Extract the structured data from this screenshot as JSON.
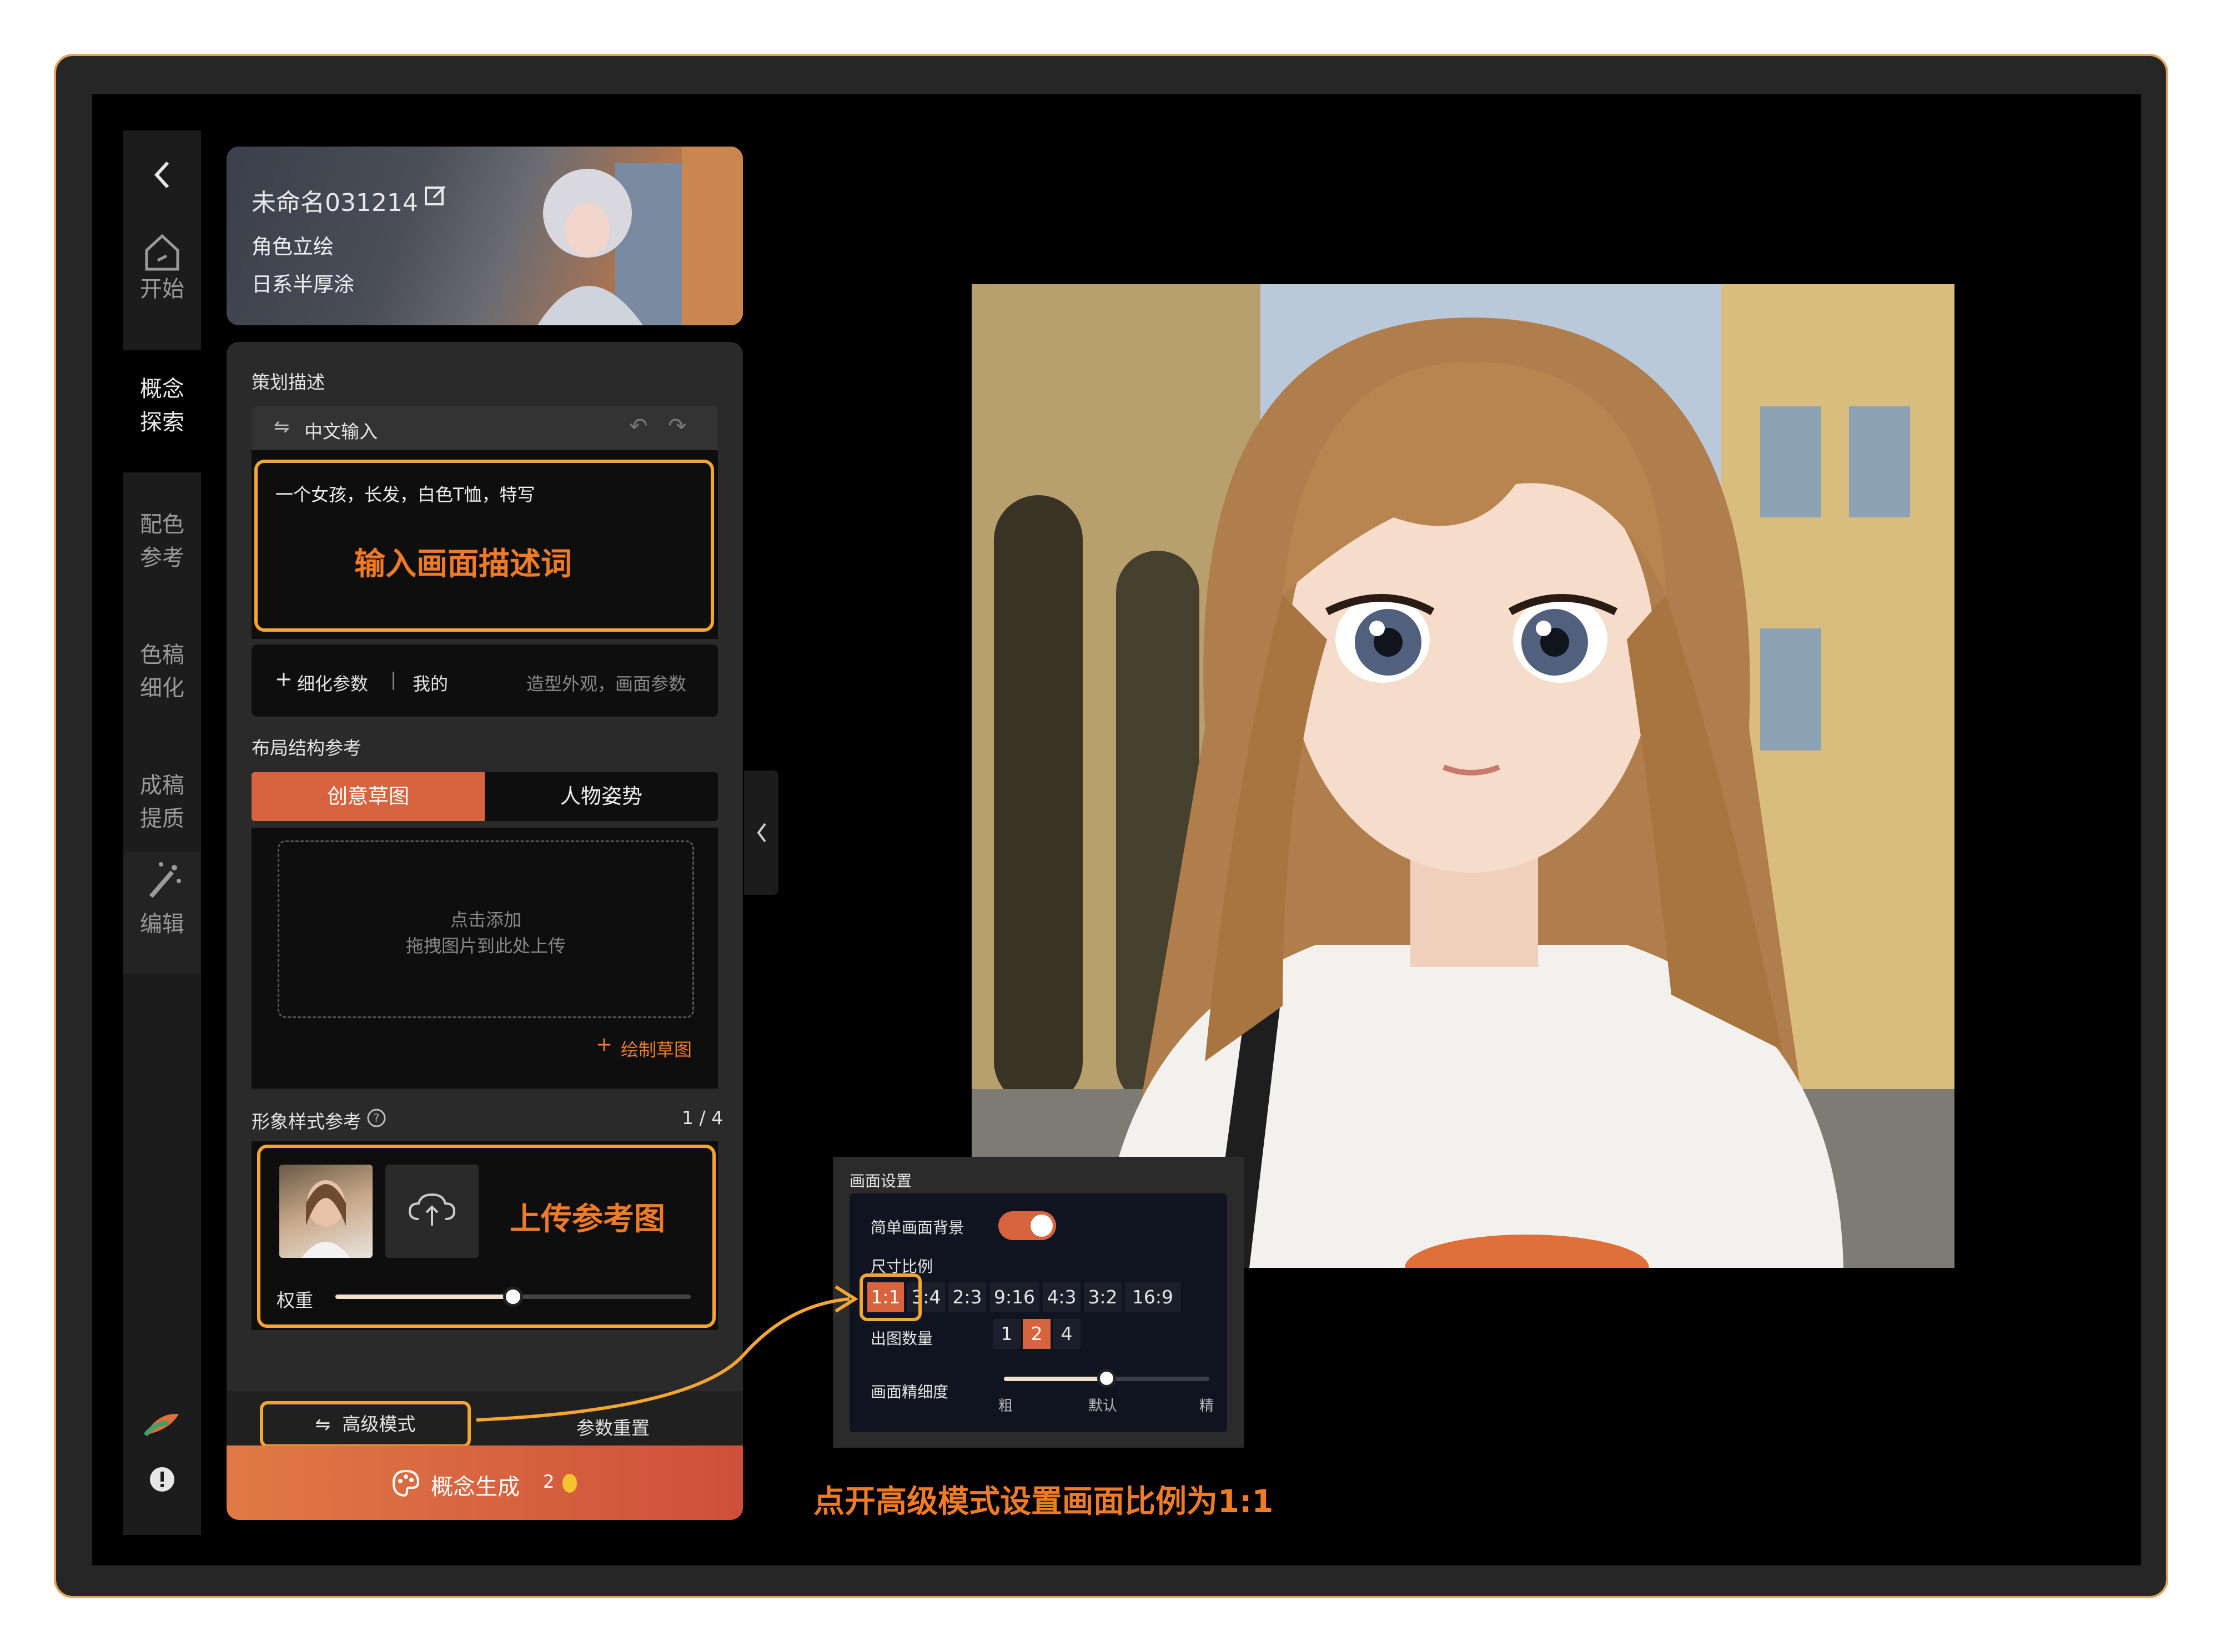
{
  "sidebar": {
    "back_icon": "chevron-left-icon",
    "items": [
      {
        "label": "开始",
        "icon": "home-icon"
      },
      {
        "label": "概念探索"
      },
      {
        "label": "配色参考"
      },
      {
        "label": "色稿细化"
      },
      {
        "label": "成稿提质"
      },
      {
        "label": "编辑",
        "icon": "magic-wand-icon"
      }
    ],
    "logo_icon": "leaf-logo-icon",
    "alert_icon": "alert-icon"
  },
  "project": {
    "name": "未命名031214",
    "category": "角色立绘",
    "style": "日系半厚涂"
  },
  "prompt_section": {
    "title": "策划描述",
    "input_mode": "中文输入",
    "prompt_text": "一个女孩，长发，白色T恤，特写",
    "annotation": "输入画面描述词"
  },
  "refine": {
    "add_label": "细化参数",
    "mine_label": "我的",
    "hint": "造型外观，画面参数"
  },
  "layout_section": {
    "title": "布局结构参考",
    "tabs": [
      "创意草图",
      "人物姿势"
    ],
    "active_tab": 0,
    "drop_line1": "点击添加",
    "drop_line2": "拖拽图片到此处上传",
    "draw_sketch": "绘制草图"
  },
  "style_ref": {
    "title": "形象样式参考",
    "count": "1 / 4",
    "annotation": "上传参考图",
    "weight_label": "权重",
    "weight_value": 0.5
  },
  "bottom": {
    "advanced_mode": "高级模式",
    "reset": "参数重置",
    "generate": "概念生成",
    "cost": "2"
  },
  "settings_popup": {
    "title": "画面设置",
    "simple_bg_label": "简单画面背景",
    "simple_bg_on": true,
    "ratio_label": "尺寸比例",
    "ratios": [
      "1:1",
      "3:4",
      "2:3",
      "9:16",
      "4:3",
      "3:2",
      "16:9"
    ],
    "selected_ratio": "1:1",
    "count_label": "出图数量",
    "counts": [
      "1",
      "2",
      "4"
    ],
    "selected_count": "2",
    "detail_label": "画面精细度",
    "detail_marks": [
      "粗",
      "默认",
      "精"
    ],
    "detail_value": 0.5
  },
  "annotation_bottom": "点开高级模式设置画面比例为1:1",
  "colors": {
    "accent": "#f07b26",
    "highlight_border": "#f5a531",
    "generate_start": "#e07a45",
    "generate_end": "#cf4f3a"
  }
}
